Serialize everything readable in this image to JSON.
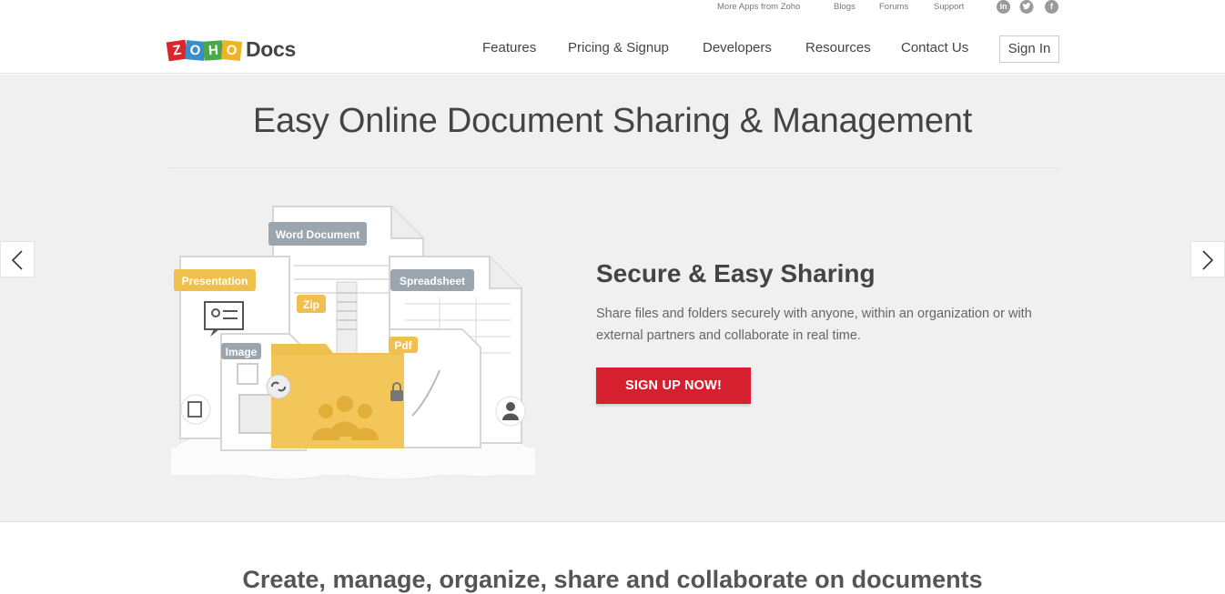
{
  "utility": {
    "links": [
      "More Apps from Zoho",
      "Blogs",
      "Forums",
      "Support"
    ],
    "social": [
      {
        "name": "linkedin-icon",
        "glyph": "in"
      },
      {
        "name": "twitter-icon",
        "glyph": "🐦"
      },
      {
        "name": "facebook-icon",
        "glyph": "f"
      }
    ]
  },
  "header": {
    "logo_letters": [
      "Z",
      "O",
      "H",
      "O"
    ],
    "logo_product": "Docs",
    "nav": [
      "Features",
      "Pricing & Signup",
      "Developers",
      "Resources",
      "Contact Us"
    ],
    "signin_label": "Sign In"
  },
  "hero": {
    "title": "Easy Online Document Sharing & Management",
    "illustration_labels": {
      "word": "Word Document",
      "presentation": "Presentation",
      "spreadsheet": "Spreadsheet",
      "zip": "Zip",
      "image": "Image",
      "pdf": "Pdf"
    },
    "feature_title": "Secure & Easy Sharing",
    "feature_desc": "Share files and folders securely with anyone, within an organization or with external partners and collaborate in real time.",
    "cta_label": "SIGN UP NOW!",
    "colors": {
      "cta": "#d7202f",
      "folder": "#f0c04e",
      "tag_gray": "#9aa5ad",
      "tag_yellow": "#f0c04e"
    }
  },
  "section": {
    "title": "Create, manage, organize, share and collaborate on documents"
  }
}
